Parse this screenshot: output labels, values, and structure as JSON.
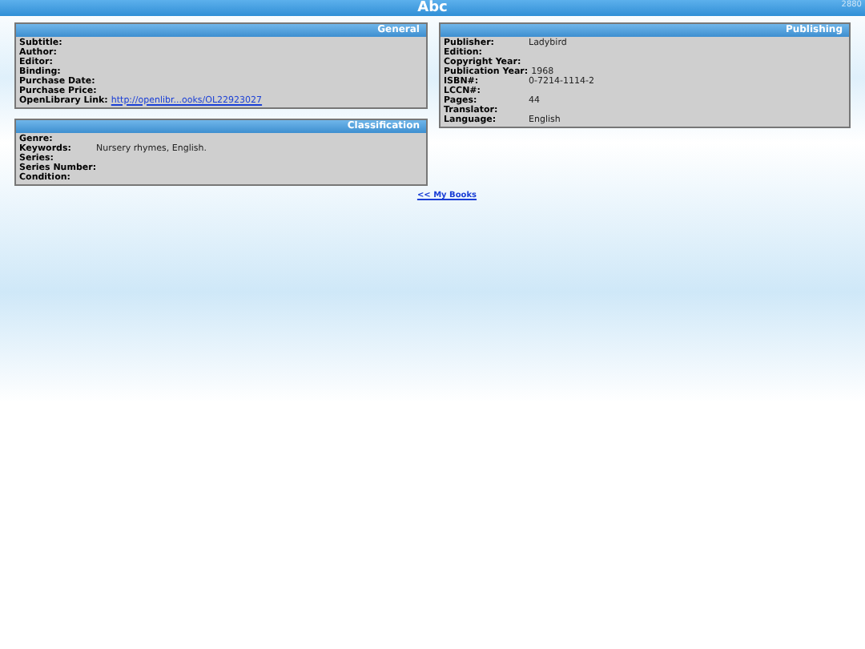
{
  "header": {
    "title": "Abc",
    "count": "2880"
  },
  "general": {
    "title": "General",
    "fields": [
      {
        "label": "Subtitle:"
      },
      {
        "label": "Author:"
      },
      {
        "label": "Editor:"
      },
      {
        "label": "Binding:"
      },
      {
        "label": "Purchase Date:"
      },
      {
        "label": "Purchase Price:"
      },
      {
        "label": "OpenLibrary Link:",
        "value": "http://openlibr...ooks/OL22923027",
        "kind": "link"
      }
    ]
  },
  "publishing": {
    "title": "Publishing",
    "fields": [
      {
        "label": "Publisher:",
        "value": "Ladybird",
        "kind": "text"
      },
      {
        "label": "Edition:"
      },
      {
        "label": "Copyright Year:"
      },
      {
        "label": "Publication Year:",
        "value": "1968",
        "kind": "text"
      },
      {
        "label": "ISBN#:",
        "value": "0-7214-1114-2",
        "kind": "text"
      },
      {
        "label": "LCCN#:"
      },
      {
        "label": "Pages:",
        "value": "44",
        "kind": "text"
      },
      {
        "label": "Translator:"
      },
      {
        "label": "Language:",
        "value": "English",
        "kind": "text"
      }
    ]
  },
  "classification": {
    "title": "Classification",
    "fields": [
      {
        "label": "Genre:"
      },
      {
        "label": "Keywords:",
        "value": "Nursery rhymes, English.",
        "kind": "text"
      },
      {
        "label": "Series:"
      },
      {
        "label": "Series Number:"
      },
      {
        "label": "Condition:"
      }
    ]
  },
  "back_link": "<< My Books"
}
